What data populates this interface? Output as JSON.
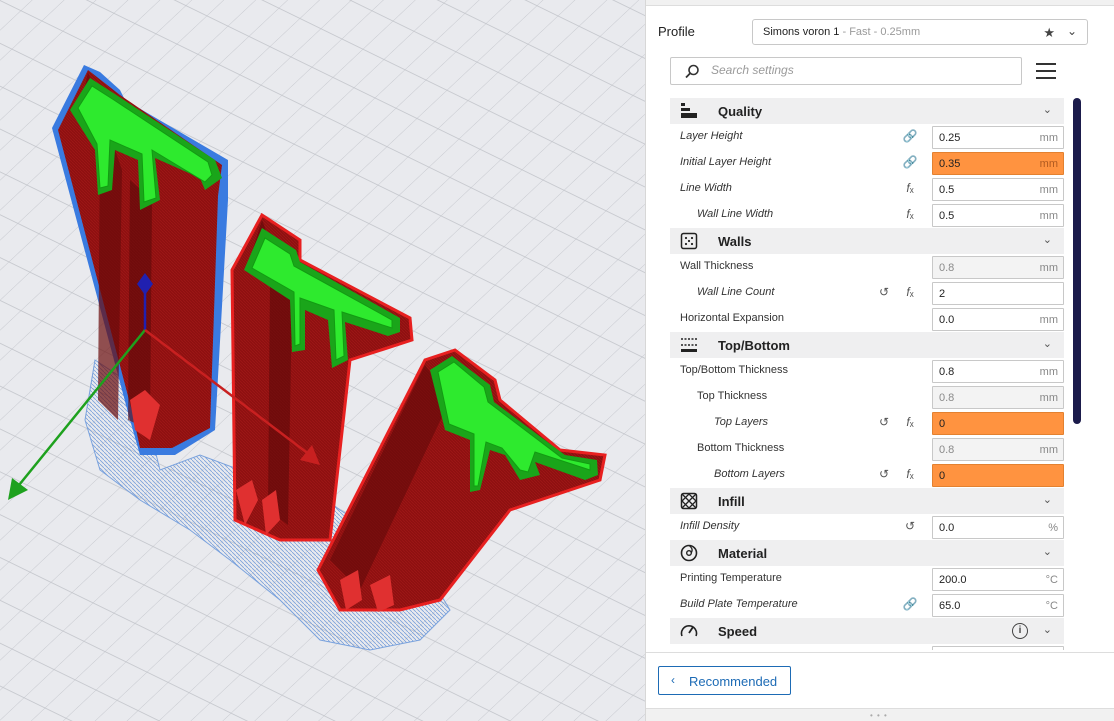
{
  "profile": {
    "label": "Profile",
    "name": "Simons voron 1",
    "sub": " - Fast - 0.25mm"
  },
  "search": {
    "placeholder": "Search settings"
  },
  "categories": {
    "quality": {
      "title": "Quality"
    },
    "walls": {
      "title": "Walls"
    },
    "topbottom": {
      "title": "Top/Bottom"
    },
    "infill": {
      "title": "Infill"
    },
    "material": {
      "title": "Material"
    },
    "speed": {
      "title": "Speed"
    }
  },
  "settings": {
    "layer_height": {
      "label": "Layer Height",
      "value": "0.25",
      "unit": "mm"
    },
    "initial_layer_height": {
      "label": "Initial Layer Height",
      "value": "0.35",
      "unit": "mm"
    },
    "line_width": {
      "label": "Line Width",
      "value": "0.5",
      "unit": "mm"
    },
    "wall_line_width": {
      "label": "Wall Line Width",
      "value": "0.5",
      "unit": "mm"
    },
    "wall_thickness": {
      "label": "Wall Thickness",
      "value": "0.8",
      "unit": "mm"
    },
    "wall_line_count": {
      "label": "Wall Line Count",
      "value": "2",
      "unit": ""
    },
    "horizontal_expansion": {
      "label": "Horizontal Expansion",
      "value": "0.0",
      "unit": "mm"
    },
    "topbottom_thickness": {
      "label": "Top/Bottom Thickness",
      "value": "0.8",
      "unit": "mm"
    },
    "top_thickness": {
      "label": "Top Thickness",
      "value": "0.8",
      "unit": "mm"
    },
    "top_layers": {
      "label": "Top Layers",
      "value": "0",
      "unit": ""
    },
    "bottom_thickness": {
      "label": "Bottom Thickness",
      "value": "0.8",
      "unit": "mm"
    },
    "bottom_layers": {
      "label": "Bottom Layers",
      "value": "0",
      "unit": ""
    },
    "infill_density": {
      "label": "Infill Density",
      "value": "0.0",
      "unit": "%"
    },
    "printing_temperature": {
      "label": "Printing Temperature",
      "value": "200.0",
      "unit": "°C"
    },
    "build_plate_temperature": {
      "label": "Build Plate Temperature",
      "value": "65.0",
      "unit": "°C"
    }
  },
  "footer": {
    "recommended_label": "Recommended"
  },
  "colors": {
    "accent": "#1d6bb5",
    "warning_field": "#ff9340",
    "scrollbar": "#1b1b4b",
    "model_red": "#8c0f0f",
    "model_green": "#28e028"
  }
}
